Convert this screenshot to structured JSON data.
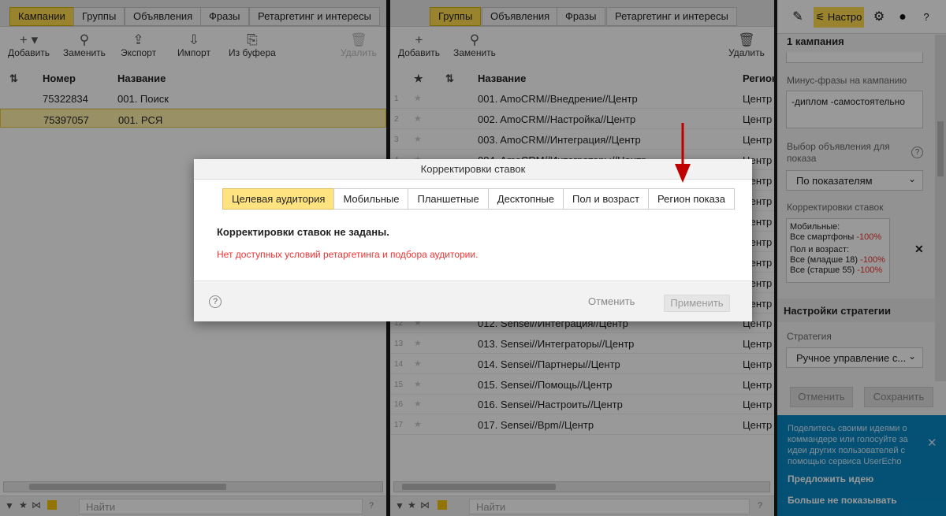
{
  "left": {
    "tabs": [
      "Кампании",
      "Группы",
      "Объявления",
      "Фразы",
      "Ретаргетинг и интересы"
    ],
    "toolbar": {
      "add": "Добавить",
      "replace": "Заменить",
      "export": "Экспорт",
      "import": "Импорт",
      "from_buffer": "Из буфера",
      "delete": "Удалить"
    },
    "columns": {
      "number": "Номер",
      "name": "Название"
    },
    "rows": [
      {
        "number": "75322834",
        "name": "001. Поиск"
      },
      {
        "number": "75397057",
        "name": "001. РСЯ"
      }
    ],
    "search_placeholder": "Найти",
    "help": "?"
  },
  "middle": {
    "tabs": [
      "Группы",
      "Объявления",
      "Фразы",
      "Ретаргетинг и интересы"
    ],
    "toolbar": {
      "add": "Добавить",
      "replace": "Заменить",
      "delete": "Удалить"
    },
    "columns": {
      "name": "Название",
      "region": "Регион"
    },
    "rows": [
      {
        "n": "1",
        "name": "001. AmoCRM//Внедрение//Центр",
        "region": "Центр"
      },
      {
        "n": "2",
        "name": "002. AmoCRM//Настройка//Центр",
        "region": "Центр"
      },
      {
        "n": "3",
        "name": "003. AmoCRM//Интеграция//Центр",
        "region": "Центр"
      },
      {
        "n": "4",
        "name": "004. AmoCRM//Интеграторы//Центр",
        "region": "Центр"
      },
      {
        "n": "12",
        "name": "012. Sensei//Интеграция//Центр",
        "region": "Центр"
      },
      {
        "n": "13",
        "name": "013. Sensei//Интеграторы//Центр",
        "region": "Центр"
      },
      {
        "n": "14",
        "name": "014. Sensei//Партнеры//Центр",
        "region": "Центр"
      },
      {
        "n": "15",
        "name": "015. Sensei//Помощь//Центр",
        "region": "Центр"
      },
      {
        "n": "16",
        "name": "016. Sensei//Настроить//Центр",
        "region": "Центр"
      },
      {
        "n": "17",
        "name": "017. Sensei//Bpm//Центр",
        "region": "Центр"
      }
    ],
    "search_placeholder": "Найти",
    "help": "?"
  },
  "right": {
    "settings_tab": "Настро",
    "title": "1 кампания",
    "minus_label": "Минус-фразы на кампанию",
    "minus_value": "-диплом -самостоятельно",
    "ad_select_label": "Выбор объявления для показа",
    "ad_select_value": "По показателям",
    "bid_label": "Корректировки ставок",
    "bid_lines": [
      {
        "text": "Мобильные:",
        "pct": ""
      },
      {
        "text": "Все смартфоны",
        "pct": "-100%"
      },
      {
        "text": "Пол и возраст:",
        "pct": ""
      },
      {
        "text": "Все (младше 18)",
        "pct": "-100%"
      },
      {
        "text": "Все (старше 55)",
        "pct": "-100%"
      }
    ],
    "strategy_header": "Настройки стратегии",
    "strategy_label": "Стратегия",
    "strategy_value": "Ручное управление с...",
    "cancel": "Отменить",
    "save": "Сохранить",
    "userecho_text": "Поделитесь своими идеями о коммандере или голосуйте за идеи других пользователей с помощью сервиса UserEcho",
    "suggest": "Предложить идею",
    "dont_show": "Больше не показывать"
  },
  "modal": {
    "title": "Корректировки ставок",
    "tabs": [
      "Целевая аудитория",
      "Мобильные",
      "Планшетные",
      "Десктопные",
      "Пол и возраст",
      "Регион показа"
    ],
    "message": "Корректировки ставок не заданы.",
    "error": "Нет доступных условий ретаргетинга и подбора аудитории.",
    "cancel": "Отменить",
    "apply": "Применить",
    "help": "?"
  },
  "colors": {
    "accent": "#ffdb4d",
    "arrow": "#c00000",
    "error": "#e33333",
    "userecho": "#0788c4"
  }
}
